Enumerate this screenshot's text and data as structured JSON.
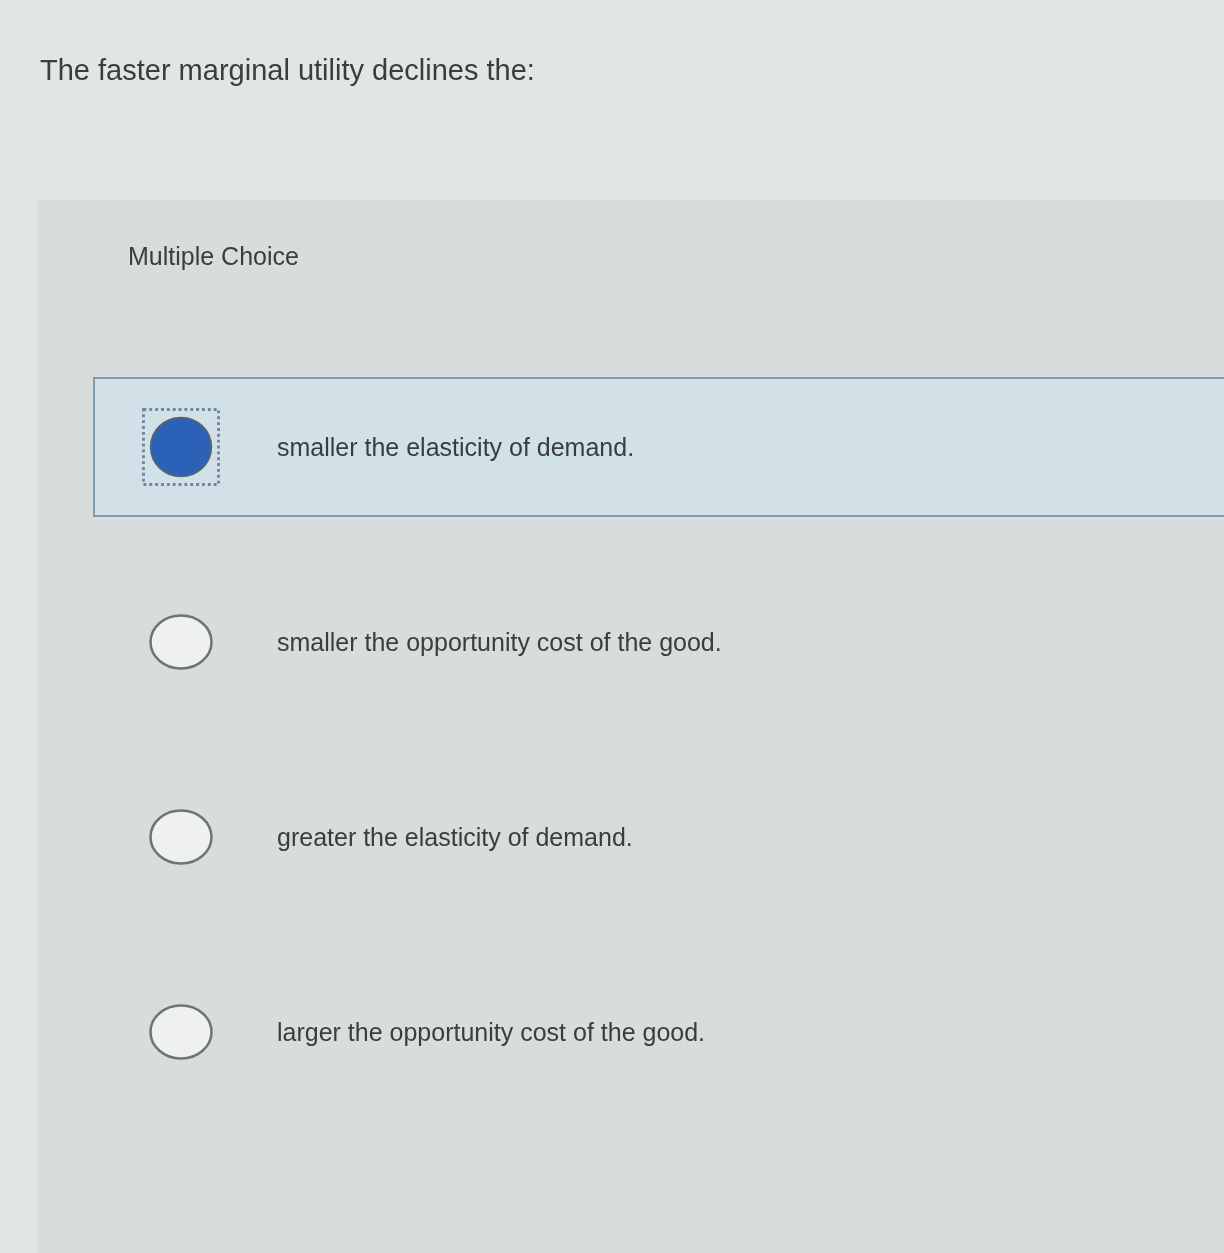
{
  "question": "The faster marginal utility declines the:",
  "answer_panel": {
    "label": "Multiple Choice",
    "options": [
      {
        "text": "smaller the elasticity of demand.",
        "selected": true
      },
      {
        "text": "smaller the opportunity cost of the good.",
        "selected": false
      },
      {
        "text": "greater the elasticity of demand.",
        "selected": false
      },
      {
        "text": "larger the opportunity cost of the good.",
        "selected": false
      }
    ]
  }
}
